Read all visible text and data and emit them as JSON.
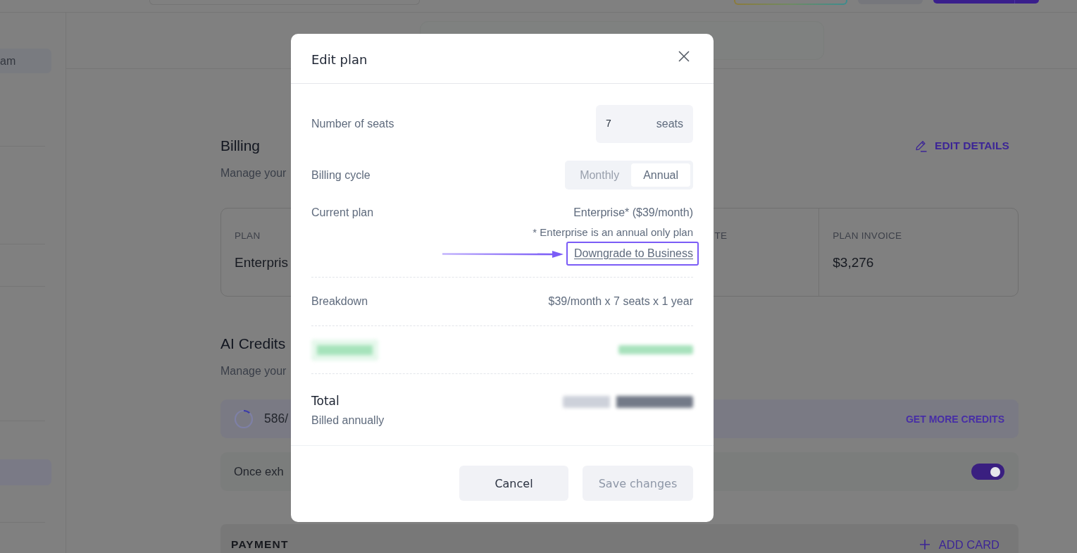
{
  "sidebar": {
    "team": "am"
  },
  "page": {
    "billing": {
      "title": "Billing",
      "subtitle": "Manage your",
      "edit_button": "EDIT DETAILS",
      "plan_card": [
        {
          "label": "PLAN",
          "value": "Enterpris"
        },
        {
          "label": "TE"
        },
        {
          "label": "PLAN INVOICE",
          "value": "$3,276"
        }
      ]
    },
    "ai_credits": {
      "title": "AI Credits",
      "subtitle": "Manage your",
      "usage": {
        "text": "586/",
        "level": 0.12
      },
      "action": "GET MORE CREDITS",
      "auto_recharge": {
        "label": "Once exh",
        "on": true
      }
    },
    "payment": {
      "title": "PAYMENT",
      "action": "ADD CARD"
    }
  },
  "modal": {
    "title": "Edit plan",
    "seats": {
      "label": "Number of seats",
      "value": "7",
      "unit": "seats"
    },
    "billing_cycle": {
      "label": "Billing cycle",
      "options": [
        {
          "label": "Monthly",
          "selected": false
        },
        {
          "label": "Annual",
          "selected": true
        }
      ]
    },
    "current_plan": {
      "label": "Current plan",
      "value": "Enterprise* ($39/month)",
      "note": "* Enterprise is an annual only plan",
      "link": {
        "label": "Downgrade to Business",
        "highlighted": true
      }
    },
    "breakdown": {
      "label": "Breakdown",
      "value": "$39/month x 7 seats x 1 year"
    },
    "total": {
      "label": "Total",
      "note": "Billed annually"
    },
    "buttons": [
      {
        "label": "Cancel",
        "disabled": false
      },
      {
        "label": "Save changes",
        "disabled": true
      }
    ]
  }
}
